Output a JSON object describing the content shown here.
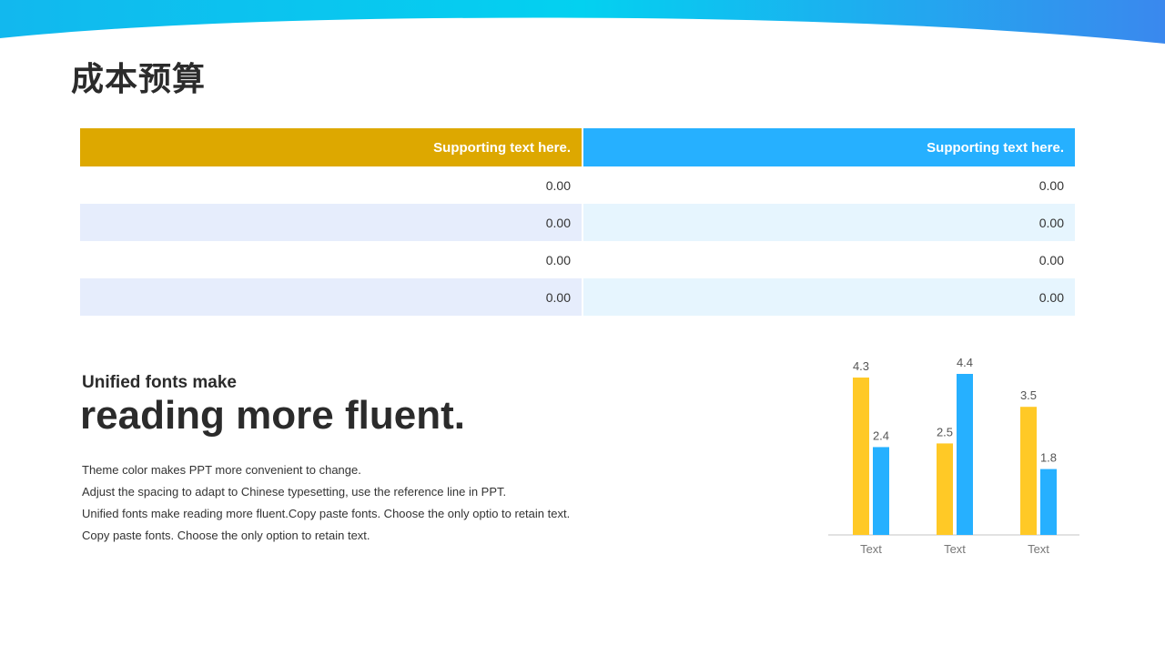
{
  "title": "成本预算",
  "colors": {
    "accent_gold": "#DDA800",
    "accent_blue": "#26B0FF",
    "bar_yellow": "#FFC926",
    "bar_blue": "#26B0FF"
  },
  "table": {
    "headers": [
      "Supporting text here.",
      "Supporting text here."
    ],
    "rows": [
      [
        "0.00",
        "0.00"
      ],
      [
        "0.00",
        "0.00"
      ],
      [
        "0.00",
        "0.00"
      ],
      [
        "0.00",
        "0.00"
      ]
    ]
  },
  "text": {
    "subheading": "Unified fonts make",
    "heading": "reading more fluent.",
    "lines": [
      "Theme color makes PPT more convenient to change.",
      "Adjust the spacing to adapt to Chinese typesetting, use the reference line in PPT.",
      "Unified fonts make reading more fluent.Copy paste fonts. Choose the only optio to retain text.",
      "Copy paste  fonts. Choose the only option to retain text."
    ]
  },
  "chart_data": {
    "type": "bar",
    "categories": [
      "Text",
      "Text",
      "Text"
    ],
    "series": [
      {
        "values": [
          4.3,
          2.5,
          3.5
        ],
        "color": "#FFC926"
      },
      {
        "values": [
          2.4,
          4.4,
          1.8
        ],
        "color": "#26B0FF"
      }
    ],
    "ylim": [
      0,
      4.4
    ],
    "grid": false,
    "legend": "none"
  }
}
